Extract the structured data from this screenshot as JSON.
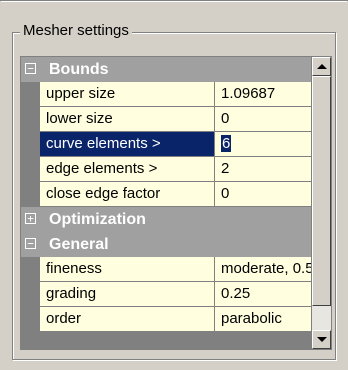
{
  "group": {
    "title": "Mesher settings"
  },
  "categories": [
    {
      "label": "Bounds",
      "expander": "⊟",
      "properties": [
        {
          "name": "upper size",
          "value": "1.09687"
        },
        {
          "name": "lower size",
          "value": "0"
        },
        {
          "name": "curve elements >",
          "value": "6",
          "selected": true
        },
        {
          "name": "edge elements >",
          "value": "2"
        },
        {
          "name": "close edge factor",
          "value": "0"
        }
      ]
    },
    {
      "label": "Optimization",
      "expander": "⊞",
      "properties": []
    },
    {
      "label": "General",
      "expander": "⊟",
      "properties": [
        {
          "name": "fineness",
          "value": "moderate, 0.5"
        },
        {
          "name": "grading",
          "value": "0.25"
        },
        {
          "name": "order",
          "value": "parabolic"
        }
      ]
    }
  ],
  "colors": {
    "selection": "#0a246a",
    "property_bg": "#ffffe0",
    "category_bg": "#a0a0a0"
  },
  "icons": {
    "scroll_up": "triangle-up-icon",
    "scroll_down": "triangle-down-icon"
  }
}
